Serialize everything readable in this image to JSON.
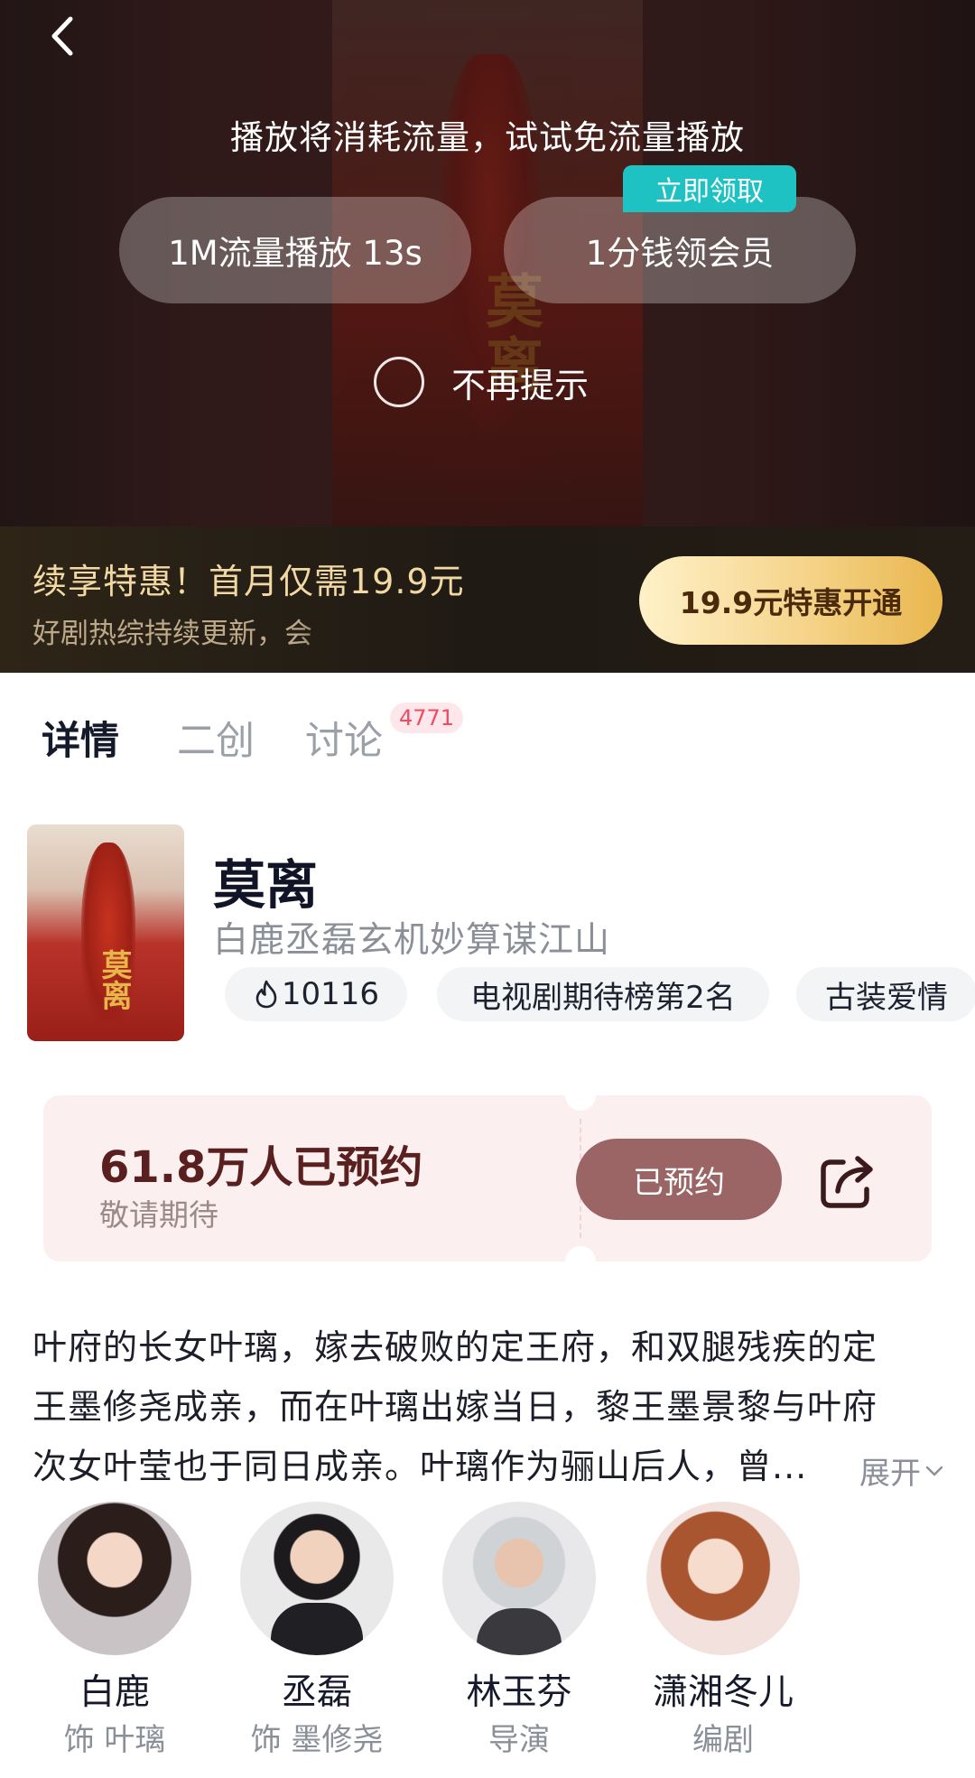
{
  "player": {
    "notice": "播放将消耗流量，试试免流量播放",
    "data_play_label": "1M流量播放 13s",
    "vip_cent_label": "1分钱领会员",
    "claim_badge": "立即领取",
    "no_remind_label": "不再提示",
    "poster_title": "莫离"
  },
  "vip_banner": {
    "title": "续享特惠！首月仅需19.9元",
    "subtitle": "好剧热综持续更新，会",
    "button_label": "19.9元特惠开通"
  },
  "tabs": [
    {
      "label": "详情",
      "active": true
    },
    {
      "label": "二创",
      "active": false
    },
    {
      "label": "讨论",
      "active": false,
      "count": "4771"
    }
  ],
  "show": {
    "title": "莫离",
    "subtitle": "白鹿丞磊玄机妙算谋江山",
    "heat": "10116",
    "rank_tag": "电视剧期待榜第2名",
    "genre_tag": "古装爱情",
    "thumb_title": "莫离"
  },
  "reservation": {
    "count_text": "61.8万人已预约",
    "sub_text": "敬请期待",
    "button_label": "已预约"
  },
  "description": {
    "lines": [
      "叶府的长女叶璃，嫁去破败的定王府，和双腿残疾的定",
      "王墨修尧成亲，而在叶璃出嫁当日，黎王墨景黎与叶府",
      "次女叶莹也于同日成亲。叶璃作为骊山后人，曾..."
    ],
    "expand_label": "展开"
  },
  "people": [
    {
      "name": "白鹿",
      "role": "饰 叶璃"
    },
    {
      "name": "丞磊",
      "role": "饰 墨修尧"
    },
    {
      "name": "林玉芬",
      "role": "导演"
    },
    {
      "name": "潇湘冬儿",
      "role": "编剧"
    }
  ],
  "colors": {
    "claim_badge": "#1ec2c2",
    "vip_text": "#f2d9a4",
    "reserve_button": "#9b6566",
    "reserve_card": "#fcefef",
    "tab_count": "#f04b62"
  },
  "icons": {
    "back": "chevron-left-icon",
    "heat": "flame-icon",
    "share": "share-icon",
    "expand": "chevron-down-icon"
  }
}
